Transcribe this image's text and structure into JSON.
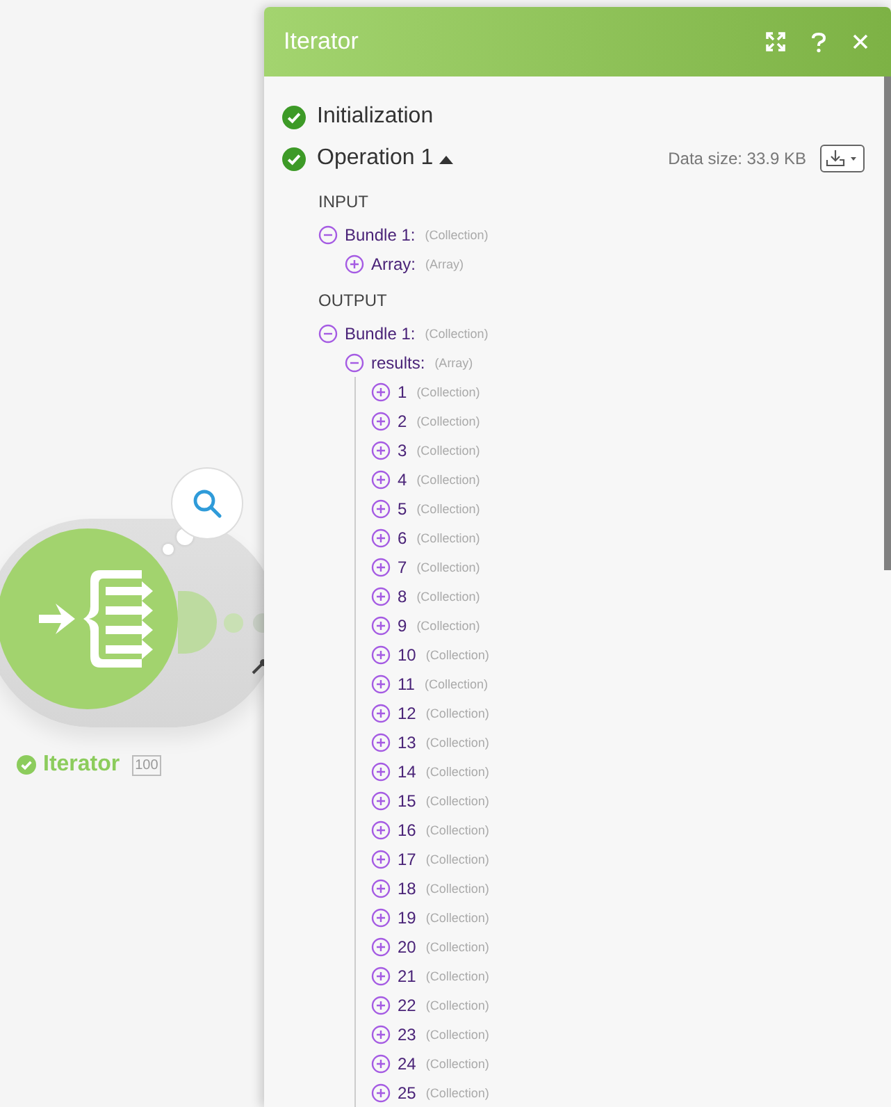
{
  "canvas": {
    "module": {
      "name": "Iterator",
      "count": "100",
      "succeeded": true
    }
  },
  "panel": {
    "title": "Iterator",
    "operations": [
      {
        "label": "Initialization",
        "succeeded": true
      },
      {
        "label": "Operation 1",
        "succeeded": true,
        "expanded": true,
        "data_size": "Data size: 33.9 KB"
      }
    ],
    "sections": [
      {
        "heading": "INPUT",
        "tree": [
          {
            "label": "Bundle 1:",
            "type": "(Collection)",
            "expanded": true,
            "children": [
              {
                "label": "Array:",
                "type": "(Array)",
                "expanded": false
              }
            ]
          }
        ]
      },
      {
        "heading": "OUTPUT",
        "tree": [
          {
            "label": "Bundle 1:",
            "type": "(Collection)",
            "expanded": true,
            "children": [
              {
                "label": "results:",
                "type": "(Array)",
                "expanded": true,
                "children": [
                  {
                    "label": "1",
                    "type": "(Collection)",
                    "expanded": false
                  },
                  {
                    "label": "2",
                    "type": "(Collection)",
                    "expanded": false
                  },
                  {
                    "label": "3",
                    "type": "(Collection)",
                    "expanded": false
                  },
                  {
                    "label": "4",
                    "type": "(Collection)",
                    "expanded": false
                  },
                  {
                    "label": "5",
                    "type": "(Collection)",
                    "expanded": false
                  },
                  {
                    "label": "6",
                    "type": "(Collection)",
                    "expanded": false
                  },
                  {
                    "label": "7",
                    "type": "(Collection)",
                    "expanded": false
                  },
                  {
                    "label": "8",
                    "type": "(Collection)",
                    "expanded": false
                  },
                  {
                    "label": "9",
                    "type": "(Collection)",
                    "expanded": false
                  },
                  {
                    "label": "10",
                    "type": "(Collection)",
                    "expanded": false
                  },
                  {
                    "label": "11",
                    "type": "(Collection)",
                    "expanded": false
                  },
                  {
                    "label": "12",
                    "type": "(Collection)",
                    "expanded": false
                  },
                  {
                    "label": "13",
                    "type": "(Collection)",
                    "expanded": false
                  },
                  {
                    "label": "14",
                    "type": "(Collection)",
                    "expanded": false
                  },
                  {
                    "label": "15",
                    "type": "(Collection)",
                    "expanded": false
                  },
                  {
                    "label": "16",
                    "type": "(Collection)",
                    "expanded": false
                  },
                  {
                    "label": "17",
                    "type": "(Collection)",
                    "expanded": false
                  },
                  {
                    "label": "18",
                    "type": "(Collection)",
                    "expanded": false
                  },
                  {
                    "label": "19",
                    "type": "(Collection)",
                    "expanded": false
                  },
                  {
                    "label": "20",
                    "type": "(Collection)",
                    "expanded": false
                  },
                  {
                    "label": "21",
                    "type": "(Collection)",
                    "expanded": false
                  },
                  {
                    "label": "22",
                    "type": "(Collection)",
                    "expanded": false
                  },
                  {
                    "label": "23",
                    "type": "(Collection)",
                    "expanded": false
                  },
                  {
                    "label": "24",
                    "type": "(Collection)",
                    "expanded": false
                  },
                  {
                    "label": "25",
                    "type": "(Collection)",
                    "expanded": false
                  }
                ]
              }
            ]
          }
        ]
      }
    ]
  }
}
